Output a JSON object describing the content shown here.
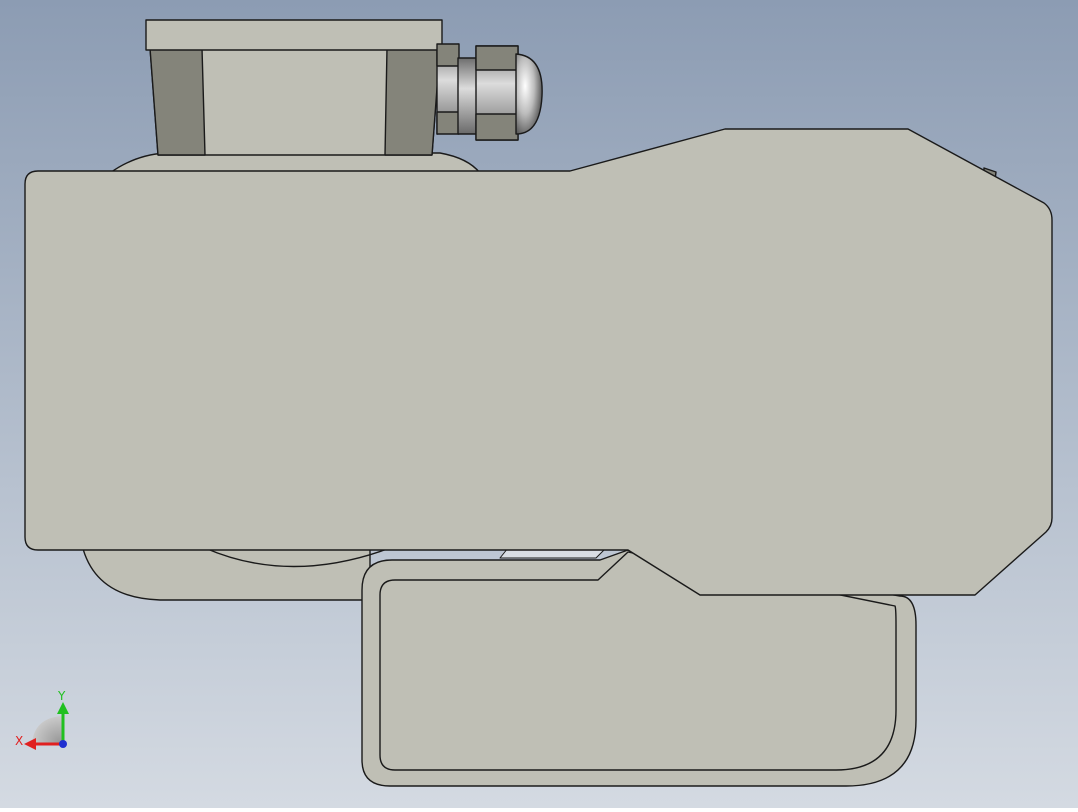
{
  "scene": {
    "background_top": "#8c9cb3",
    "background_bottom": "#d4dae2",
    "part_fill": "#bfbfb5",
    "part_shadow": "#84847a",
    "edge_color": "#1a1a1a",
    "metal_light": "#f2f2f2",
    "metal_dark": "#505050"
  },
  "triad": {
    "x_label": "X",
    "y_label": "Y",
    "x_color": "#e02020",
    "y_color": "#20c020",
    "z_color": "#2030d0"
  }
}
